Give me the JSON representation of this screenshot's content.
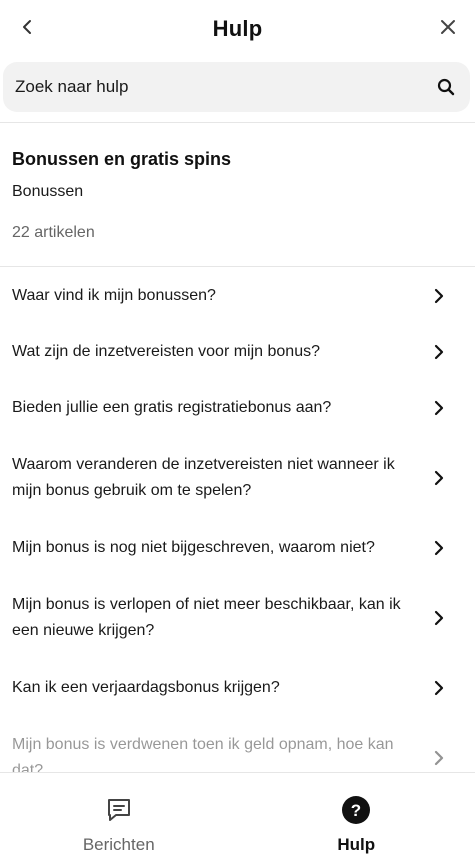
{
  "header": {
    "title": "Hulp",
    "back_icon": "chevron-left-icon",
    "close_icon": "close-icon"
  },
  "search": {
    "placeholder": "Zoek naar hulp",
    "value": "",
    "icon": "search-icon"
  },
  "category": {
    "title": "Bonussen en gratis spins",
    "subtitle": "Bonussen",
    "count": "22 artikelen"
  },
  "articles": [
    {
      "label": "Waar vind ik mijn bonussen?"
    },
    {
      "label": "Wat zijn de inzetvereisten voor mijn bonus?"
    },
    {
      "label": "Bieden jullie een gratis registratiebonus aan?"
    },
    {
      "label": "Waarom veranderen de inzetvereisten niet wanneer ik mijn bonus gebruik om te spelen?"
    },
    {
      "label": "Mijn bonus is nog niet bijgeschreven, waarom niet?"
    },
    {
      "label": "Mijn bonus is verlopen of niet meer beschikbaar, kan ik een nieuwe krijgen?"
    },
    {
      "label": "Kan ik een verjaardagsbonus krijgen?"
    },
    {
      "label": "Mijn bonus is verdwenen toen ik geld opnam, hoe kan dat?"
    }
  ],
  "bottom_nav": {
    "items": [
      {
        "label": "Berichten",
        "icon": "message-icon",
        "active": false
      },
      {
        "label": "Hulp",
        "icon": "help-icon",
        "active": true
      }
    ]
  },
  "colors": {
    "text": "#1a1a1a",
    "muted": "#666666",
    "search_bg": "#f2f2f2",
    "divider": "#e6e6e6"
  }
}
